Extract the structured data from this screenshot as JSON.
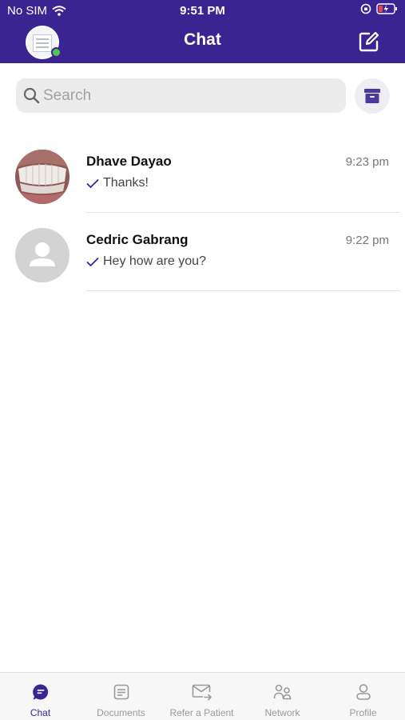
{
  "status_bar": {
    "carrier": "No SIM",
    "time": "9:51 PM"
  },
  "header": {
    "title": "Chat"
  },
  "search": {
    "placeholder": "Search"
  },
  "chats": [
    {
      "name": "Dhave Dayao",
      "time": "9:23 pm",
      "preview": "Thanks!",
      "avatar": "teeth-photo"
    },
    {
      "name": "Cedric Gabrang",
      "time": "9:22 pm",
      "preview": "Hey how are you?",
      "avatar": "default-person"
    }
  ],
  "tabbar": {
    "tabs": [
      {
        "label": "Chat",
        "icon": "chat-bubble-icon",
        "active": true
      },
      {
        "label": "Documents",
        "icon": "documents-icon",
        "active": false
      },
      {
        "label": "Refer a Patient",
        "icon": "envelope-forward-icon",
        "active": false
      },
      {
        "label": "Network",
        "icon": "network-people-icon",
        "active": false
      },
      {
        "label": "Profile",
        "icon": "profile-icon",
        "active": false
      }
    ]
  },
  "colors": {
    "brand": "#3a2491",
    "online": "#53c54a",
    "inactive_tab": "#999999"
  }
}
